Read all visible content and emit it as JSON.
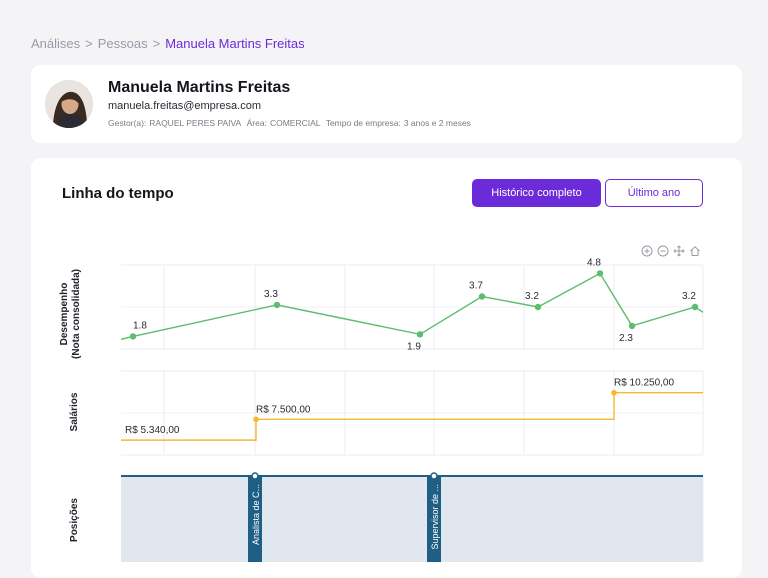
{
  "breadcrumb": {
    "items": [
      "Análises",
      "Pessoas"
    ],
    "separator": ">",
    "current": "Manuela Martins Freitas"
  },
  "profile": {
    "name": "Manuela Martins Freitas",
    "email": "manuela.freitas@empresa.com",
    "manager_label": "Gestor(a):",
    "manager": "RAQUEL PERES PAIVA",
    "area_label": "Área:",
    "area": "COMERCIAL",
    "tenure_label": "Tempo de empresa:",
    "tenure": "3 anos e 2 meses"
  },
  "timeline": {
    "title": "Linha do tempo",
    "btn_full": "Histórico completo",
    "btn_last_year": "Último ano",
    "toolbar_icons": [
      "zoom-in-icon",
      "zoom-out-icon",
      "pan-icon",
      "home-icon"
    ]
  },
  "chart_data": [
    {
      "type": "line",
      "ylabel": "Desempenho (Nota consolidada)",
      "ylabel_lines": [
        "Desempenho",
        "(Nota consolidada)"
      ],
      "values": [
        1.8,
        3.3,
        1.9,
        3.7,
        3.2,
        4.8,
        2.3,
        3.2
      ],
      "labels": [
        "1.8",
        "3.3",
        "1.9",
        "3.7",
        "3.2",
        "4.8",
        "2.3",
        "3.2"
      ],
      "color": "#5cbd6e"
    },
    {
      "type": "line",
      "step": true,
      "ylabel": "Salários",
      "values": [
        5340,
        7500,
        10250
      ],
      "labels": [
        "R$ 5.340,00",
        "R$ 7.500,00",
        "R$ 10.250,00"
      ],
      "color": "#f7b731"
    },
    {
      "type": "area",
      "ylabel": "Posições",
      "positions": [
        "Analista de C...",
        "Supervisor de ..."
      ],
      "color": "#1f5f86",
      "fill": "#e1e7ee"
    }
  ]
}
